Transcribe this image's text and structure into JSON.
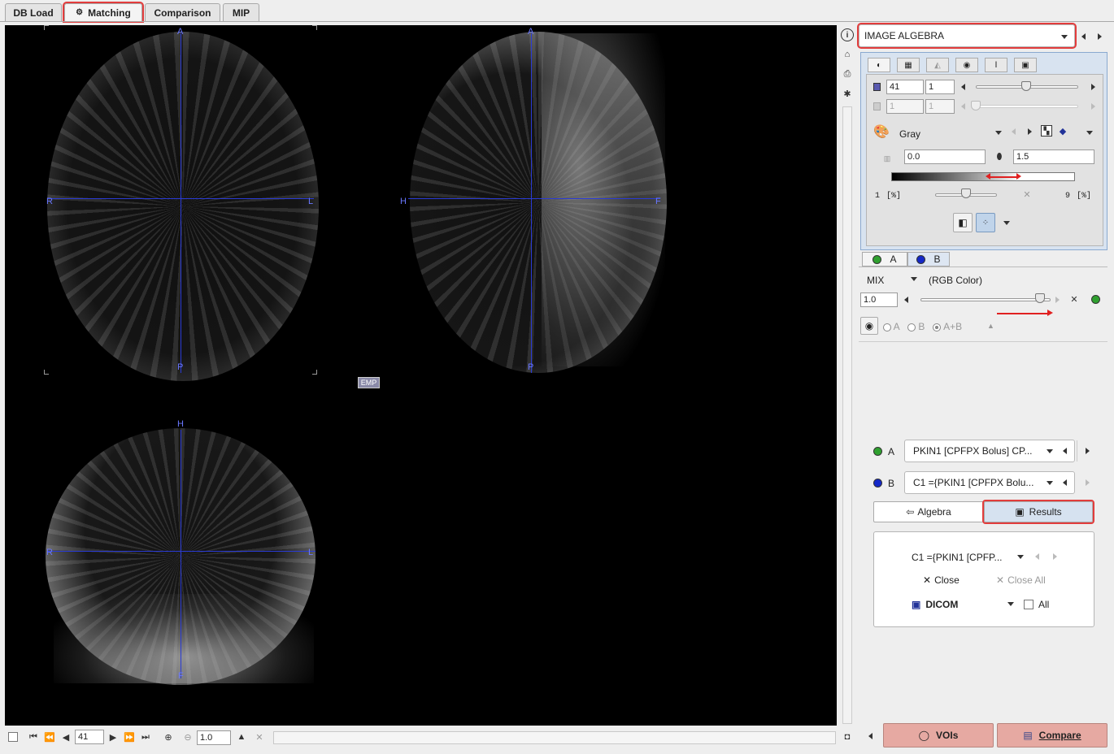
{
  "tabs": [
    {
      "label": "DB Load"
    },
    {
      "label": "Matching",
      "icon": "gear-icon"
    },
    {
      "label": "Comparison"
    },
    {
      "label": "MIP"
    }
  ],
  "viewer": {
    "orient_axial": {
      "top": "A",
      "bottom": "P",
      "left": "R",
      "right": "L"
    },
    "orient_sagittal": {
      "top": "A",
      "bottom": "P",
      "left": "H",
      "right": "F"
    },
    "orient_coronal": {
      "top": "H",
      "bottom": "F",
      "left": "R",
      "right": "L"
    },
    "emp_label": "EMP"
  },
  "bottom_toolbar": {
    "slice_value": "41",
    "zoom_value": "1.0"
  },
  "panel": {
    "mode_select": "IMAGE ALGEBRA",
    "slice_field_1": "41",
    "slice_field_2": "1",
    "frame_field_1": "1",
    "frame_field_2": "1",
    "colormap": "Gray",
    "min_value": "0.0",
    "max_value": "1.5",
    "pct_low": "1",
    "pct_low_unit": "[%]",
    "pct_high": "9",
    "pct_high_unit": "[%]",
    "layer_tab_a": "A",
    "layer_tab_b": "B",
    "mix_label": "MIX",
    "mix_mode": "(RGB Color)",
    "mix_value": "1.0",
    "mix_slider_fraction": 0.92,
    "radio_a": "A",
    "radio_b": "B",
    "radio_ab": "A+B",
    "series_a_label": "A",
    "series_a_value": "PKIN1 [CPFPX Bolus] CP...",
    "series_b_label": "B",
    "series_b_value": "C1 ={PKIN1 [CPFPX Bolu...",
    "algebra_button": "Algebra",
    "results_button": "Results",
    "result_select": "C1 ={PKIN1 [CPFP...",
    "close_label": "Close",
    "close_all_label": "Close All",
    "dicom_label": "DICOM",
    "all_label": "All",
    "vois_button": "VOIs",
    "compare_button": "Compare"
  },
  "colors": {
    "highlight": "#e23c3c",
    "series_a": "#2fa02f",
    "series_b": "#1428c8",
    "crosshair": "#2a3bd6"
  }
}
